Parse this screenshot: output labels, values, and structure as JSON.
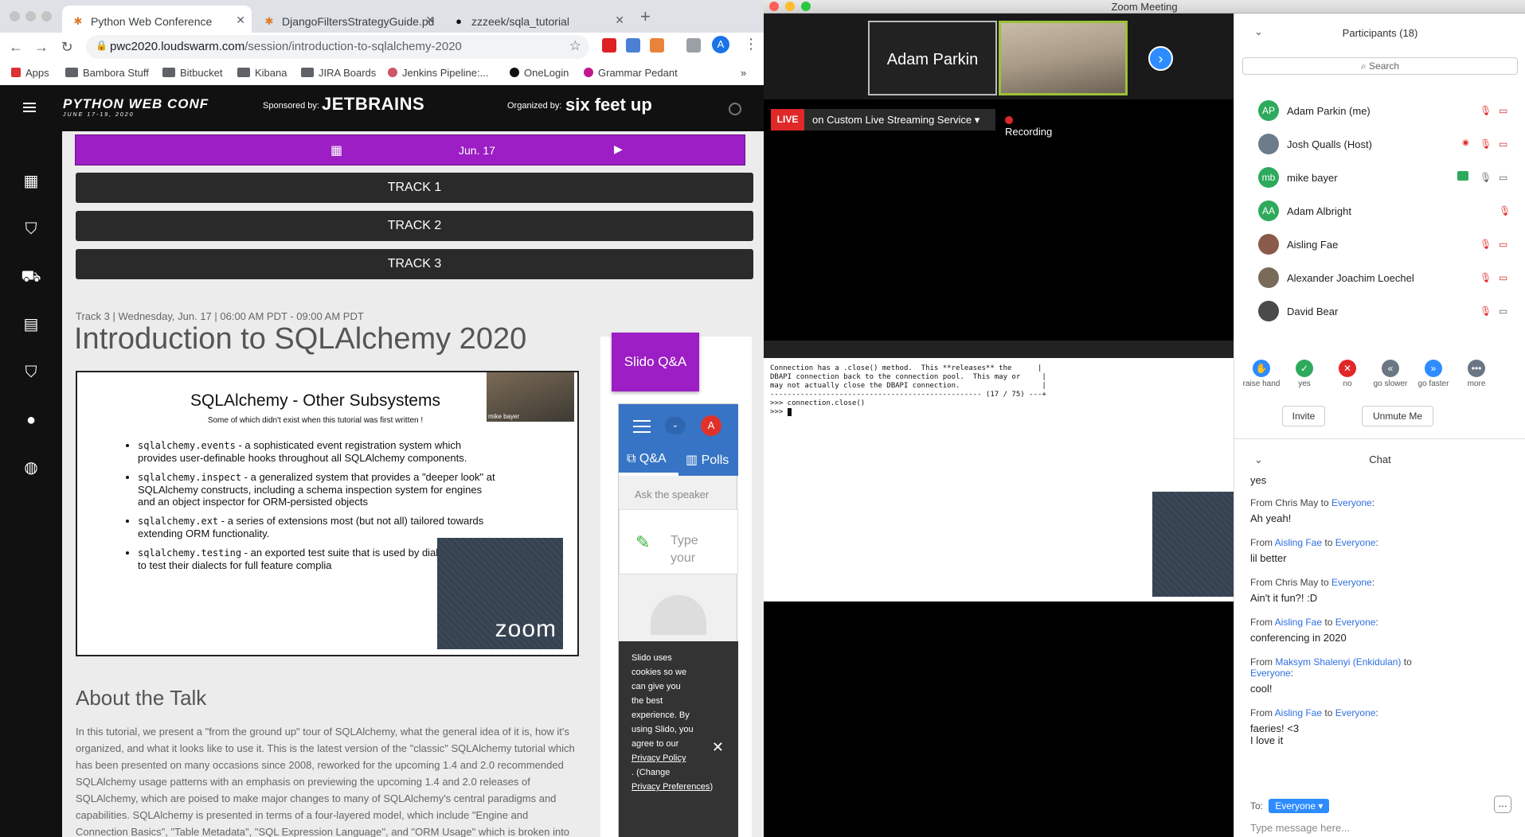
{
  "chrome": {
    "tabs": [
      {
        "title": "Python Web Conference",
        "active": true
      },
      {
        "title": "DjangoFiltersStrategyGuide.pd",
        "active": false
      },
      {
        "title": "zzzeek/sqla_tutorial",
        "active": false
      }
    ],
    "url_host": "pwc2020.loudswarm.com",
    "url_path": "/session/introduction-to-sqlalchemy-2020",
    "profile_initial": "A",
    "bookmarks": [
      "Apps",
      "Bambora Stuff",
      "Bitbucket",
      "Kibana",
      "JIRA Boards",
      "Jenkins Pipeline:...",
      "OneLogin",
      "Grammar Pedant"
    ],
    "bookmarks_more": "»"
  },
  "site": {
    "logo": "PYTHON WEB CONF",
    "logo_dates": "JUNE 17-19, 2020",
    "sponsored_by": "Sponsored by:",
    "sponsor": "JETBRAINS",
    "organized_by": "Organized by:",
    "organizer": "six feet up",
    "date": "Jun. 17",
    "tracks": [
      "TRACK 1",
      "TRACK 2",
      "TRACK 3"
    ],
    "meta": "Track 3 | Wednesday, Jun. 17 | 06:00 AM PDT - 09:00 AM PDT",
    "title": "Introduction to SQLAlchemy 2020",
    "slide": {
      "title": "SQLAlchemy - Other Subsystems",
      "subtitle": "Some of which didn't exist when this tutorial was first written !",
      "items": [
        {
          "code": "sqlalchemy.events",
          "text": " - a sophisticated event registration system which provides user-definable hooks throughout all SQLAlchemy components."
        },
        {
          "code": "sqlalchemy.inspect",
          "text": " - a generalized system that provides a \"deeper look\" at SQLAlchemy constructs, including a schema inspection system for engines and an object inspector for ORM-persisted objects"
        },
        {
          "code": "sqlalchemy.ext",
          "text": " - a series of extensions most (but not all) tailored towards extending ORM functionality."
        },
        {
          "code": "sqlalchemy.testing",
          "text": " - an exported test suite that is used by dialect authors to test their dialects for full feature complia"
        }
      ],
      "cam_label": "mike bayer",
      "zoom_logo": "zoom"
    },
    "about_heading": "About the Talk",
    "about_text": "In this tutorial, we present a \"from the ground up\" tour of SQLAlchemy, what the general idea of it is, how it's organized, and what it looks like to use it. This is the latest version of the \"classic\" SQLAlchemy tutorial which has been presented on many occasions since 2008, reworked for the upcoming 1.4 and 2.0 recommended SQLAlchemy usage patterns with an emphasis on previewing the upcoming 1.4 and 2.0 releases of SQLAlchemy, which are poised to make major changes to many of SQLAlchemy's central paradigms and capabilities. SQLAlchemy is presented in terms of a four-layered model, which include \"Engine and Connection Basics\", \"Table Metadata\", \"SQL Expression Language\", and \"ORM Usage\" which is broken into two sections and API use is presented in terms of a console runner application which",
    "slido": {
      "button": "Slido Q&A",
      "avatar": "A",
      "tab_qa": "Q&A",
      "tab_polls": "Polls",
      "ask": "Ask the speaker",
      "type_placeholder": "Type your",
      "cookie_text": "Slido uses cookies so we can give you the best experience. By using Slido, you agree to our",
      "privacy_policy": "Privacy Policy",
      "change": ". (Change",
      "privacy_prefs": "Privacy Preferences",
      "close_paren": ")"
    }
  },
  "zoom": {
    "window_title": "Zoom Meeting",
    "gallery_name": "Adam Parkin",
    "live": "LIVE",
    "stream": "on Custom Live Streaming Service",
    "recording": "Recording",
    "terminal_lines": [
      "Connection has a .close() method.  This **releases** the      |",
      "DBAPI connection back to the connection pool.  This may or     |",
      "may not actually close the DBAPI connection.                   |",
      "------------------------------------------------- (17 / 75) ---+",
      "",
      ">>> connection.close()",
      "",
      ">>> "
    ],
    "participants_header": "Participants (18)",
    "search": "Search",
    "participants": [
      {
        "initials": "AP",
        "name": "Adam Parkin (me)",
        "color": "#2eaa5c",
        "mic": "muted",
        "cam": "off"
      },
      {
        "initials": "",
        "name": "Josh Qualls (Host)",
        "color": "#6b7b8c",
        "mic": "muted",
        "cam": "off"
      },
      {
        "initials": "mb",
        "name": "mike bayer",
        "color": "#2eaa5c",
        "mic": "on",
        "cam": "on"
      },
      {
        "initials": "AA",
        "name": "Adam Albright",
        "color": "#2eaa5c",
        "mic": "muted",
        "cam": ""
      },
      {
        "initials": "",
        "name": "Aisling Fae",
        "color": "#8a5a4a",
        "mic": "muted",
        "cam": "off"
      },
      {
        "initials": "",
        "name": "Alexander Joachim Loechel",
        "color": "#7a6a5a",
        "mic": "muted",
        "cam": "off"
      },
      {
        "initials": "",
        "name": "David Bear",
        "color": "#4a4a4a",
        "mic": "muted",
        "cam": "on"
      }
    ],
    "reactions": [
      "raise hand",
      "yes",
      "no",
      "go slower",
      "go faster",
      "more"
    ],
    "invite": "Invite",
    "unmute": "Unmute Me",
    "chat_header": "Chat",
    "chat": [
      {
        "from": "",
        "who": "",
        "to": "",
        "body": "yes"
      },
      {
        "from": "From Chris May to",
        "who": "",
        "to": "Everyone",
        "body": "Ah yeah!"
      },
      {
        "from": "From",
        "who": "Aisling Fae",
        "to": "Everyone",
        "body": "lil better"
      },
      {
        "from": "From Chris May to",
        "who": "",
        "to": "Everyone",
        "body": "Ain't it fun?! :D"
      },
      {
        "from": "From",
        "who": "Aisling Fae",
        "to": "Everyone",
        "body": "conferencing in 2020"
      },
      {
        "from": "From",
        "who": "Maksym Shalenyi (Enkidulan)",
        "to": "Everyone",
        "body": "cool!"
      },
      {
        "from": "From",
        "who": "Aisling Fae",
        "to": "Everyone",
        "body": "faeries! <3\nI love it"
      }
    ],
    "to_label": "To:",
    "to_value": "Everyone",
    "type_message": "Type message here..."
  }
}
